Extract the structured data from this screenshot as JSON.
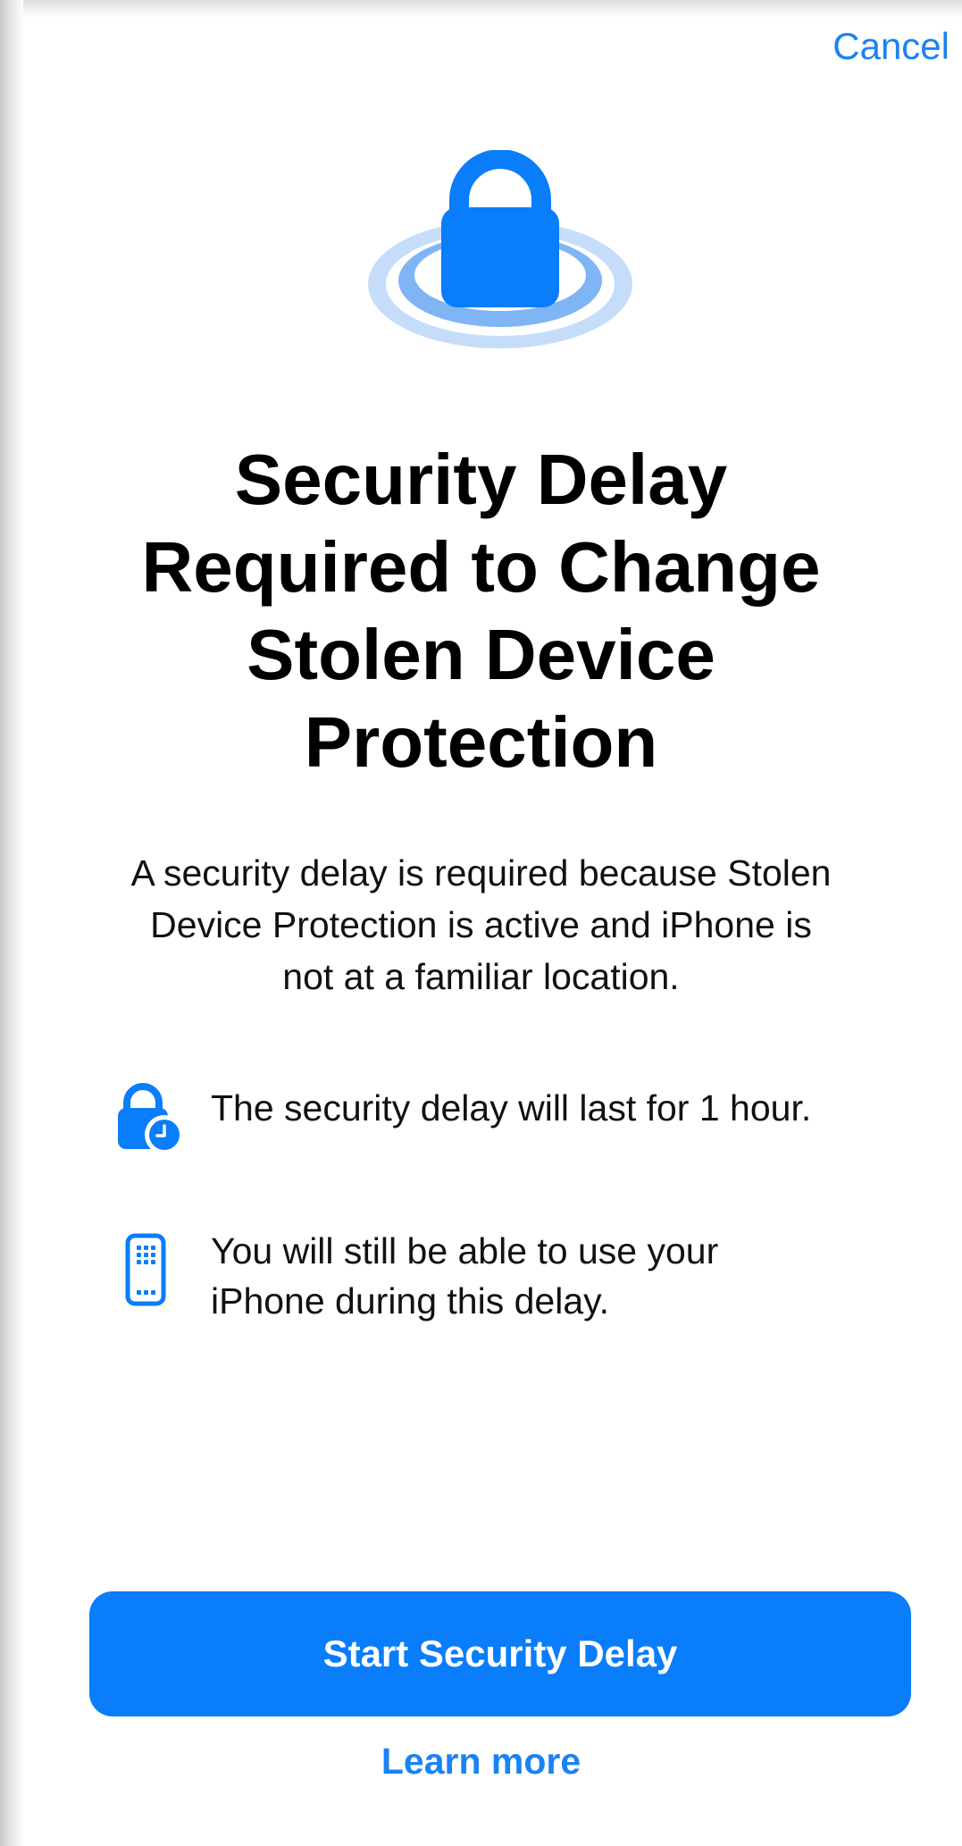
{
  "header": {
    "cancel_label": "Cancel"
  },
  "hero": {
    "icon": "lock-with-rings-icon",
    "accent_color": "#0a7dfa"
  },
  "title": "Security Delay\nRequired to Change\nStolen Device\nProtection",
  "description": "A security delay is required because Stolen\nDevice Protection is active and iPhone is\nnot at a familiar location.",
  "features": [
    {
      "icon": "lock-clock-icon",
      "text": "The security delay will last for 1 hour."
    },
    {
      "icon": "phone-keypad-icon",
      "text": "You will still be able to use your\niPhone during this delay."
    }
  ],
  "actions": {
    "primary_label": "Start Security Delay",
    "secondary_label": "Learn more"
  }
}
